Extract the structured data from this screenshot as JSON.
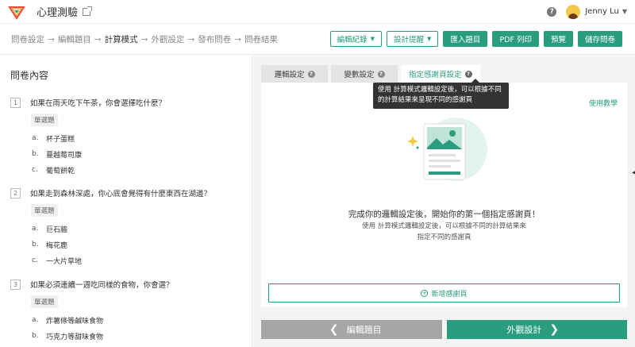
{
  "header": {
    "app_title": "心理測驗",
    "user_name": "Jenny Lu"
  },
  "steps": [
    "問卷設定",
    "編輯題目",
    "計算模式",
    "外觀設定",
    "發布問卷",
    "問卷結果"
  ],
  "toolbar": {
    "edit_log": "編輯紀錄",
    "design_tips": "設計提醒",
    "import": "匯入題目",
    "pdf": "PDF 列印",
    "preview": "預覽",
    "save": "儲存問卷"
  },
  "left": {
    "title": "問卷內容",
    "questions": [
      {
        "num": "1",
        "text": "如果在雨天吃下午茶，你會選擇吃什麼？",
        "type": "單選題",
        "options": [
          {
            "letter": "a.",
            "text": "杯子蛋糕"
          },
          {
            "letter": "b.",
            "text": "蔓越莓司康"
          },
          {
            "letter": "c.",
            "text": "葡萄餅乾"
          }
        ]
      },
      {
        "num": "2",
        "text": "如果走到森林深處，你心底會覺得有什麼東西在湖邊？",
        "type": "單選題",
        "options": [
          {
            "letter": "a.",
            "text": "巨石牆"
          },
          {
            "letter": "b.",
            "text": "梅花鹿"
          },
          {
            "letter": "c.",
            "text": "一大片草地"
          }
        ]
      },
      {
        "num": "3",
        "text": "如果必須連續一週吃同樣的食物，你會選？",
        "type": "單選題",
        "options": [
          {
            "letter": "a.",
            "text": "炸薯條等鹹味食物"
          },
          {
            "letter": "b.",
            "text": "巧克力等甜味食物"
          }
        ]
      }
    ]
  },
  "tabs": [
    "邏輯設定",
    "變數設定",
    "指定感謝頁設定"
  ],
  "tooltip": "使用  計算模式邏輯設定後，可以根據不同的計算結果來呈現不同的感謝頁",
  "tutorial_link": "使用教學",
  "empty": {
    "title": "完成你的邏輯設定後，開始你的第一個指定感謝頁！",
    "desc": "使用  計算模式邏輯設定後，可以根據不同的計算結果來指定不同的感謝頁"
  },
  "add_button": "新增感謝頁",
  "nav": {
    "prev": "編輯題目",
    "next": "外觀設計"
  },
  "colors": {
    "accent": "#2a9d7f",
    "nav_prev": "#a6a6a6"
  }
}
